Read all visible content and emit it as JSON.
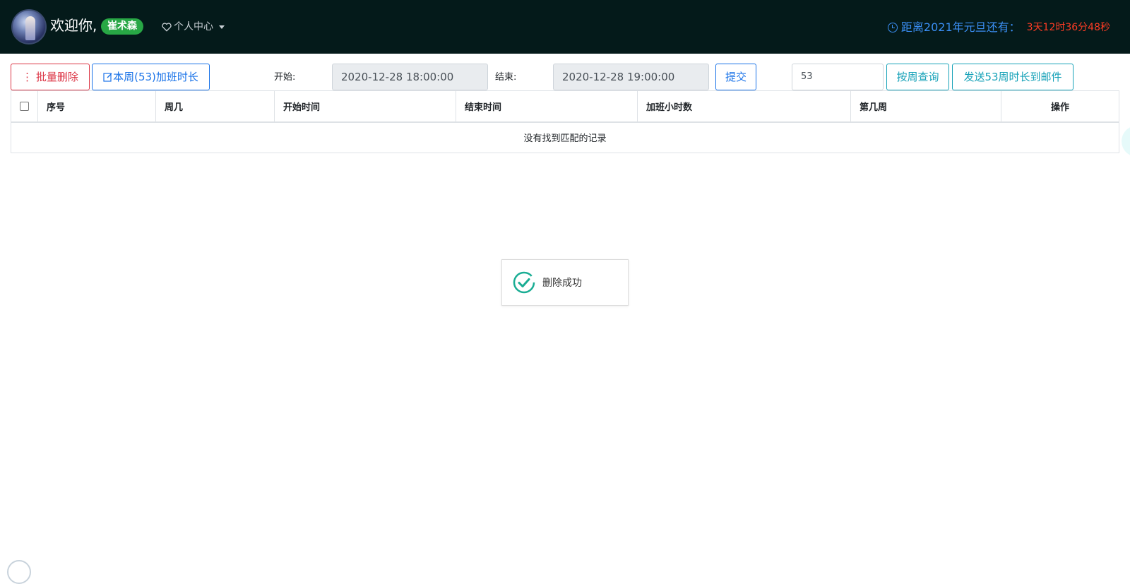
{
  "header": {
    "welcome": "欢迎你,",
    "username": "崔术森",
    "user_menu_label": "个人中心",
    "countdown_label": "距离2021年元旦还有：",
    "countdown_value": "3天12时36分48秒",
    "colors": {
      "bg": "#041a1a",
      "badge": "#28a745",
      "countdown_label": "#3b8ff5",
      "countdown_value": "#ff3c24"
    }
  },
  "toolbar": {
    "batch_delete": "⋮ 批量删除",
    "week_overtime": "本周(53)加班时长",
    "start_label": "开始:",
    "start_value": "2020-12-28 18:00:00",
    "end_label": "结束:",
    "end_value": "2020-12-28 19:00:00",
    "submit": "提交",
    "week_input_value": "53",
    "query_by_week": "按周查询",
    "send_email": "发送53周时长到邮件"
  },
  "table": {
    "headers": [
      "序号",
      "周几",
      "开始时间",
      "结束时间",
      "加班小时数",
      "第几周",
      "操作"
    ],
    "empty_message": "没有找到匹配的记录"
  },
  "toast": {
    "message": "删除成功",
    "icon": "check-circle-icon",
    "color": "#1aad94"
  },
  "icons": {
    "heart": "heart-icon",
    "clock": "clock-icon",
    "edit": "edit-icon"
  }
}
